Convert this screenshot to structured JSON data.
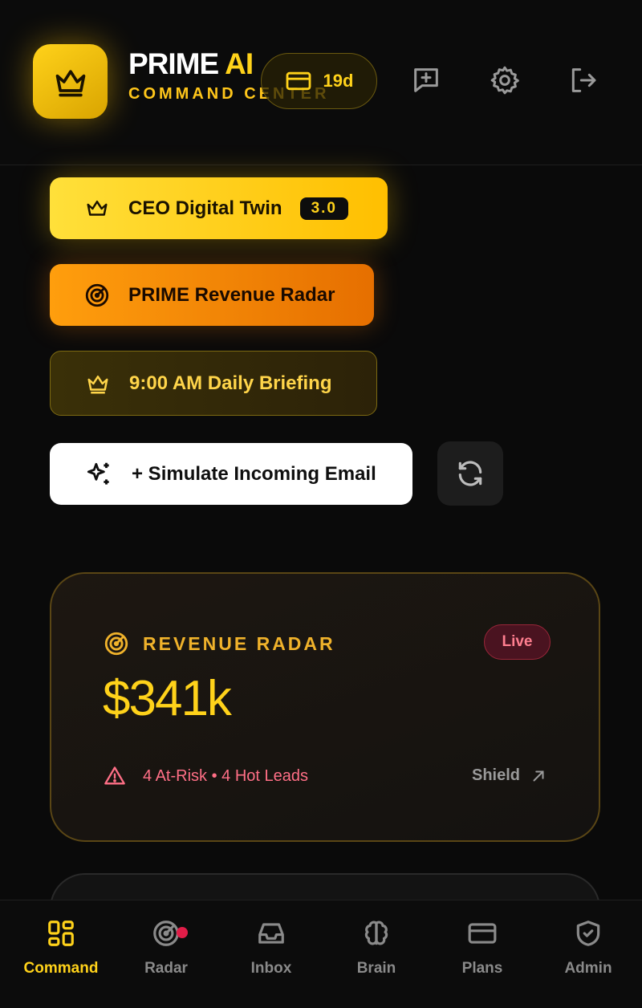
{
  "header": {
    "brand_main": "PRIME",
    "brand_ai": "AI",
    "subtitle": "COMMAND CENTER",
    "trial_days": "19d"
  },
  "actions": {
    "ceo_label": "CEO Digital Twin",
    "ceo_badge": "3.0",
    "radar_label": "PRIME Revenue Radar",
    "briefing_label": "9:00 AM Daily Briefing",
    "simulate_label": "+ Simulate Incoming Email"
  },
  "card": {
    "title": "REVENUE RADAR",
    "status": "Live",
    "amount": "$341k",
    "risk_text": "4 At-Risk • 4 Hot Leads",
    "link_label": "Shield"
  },
  "nav": {
    "items": [
      {
        "label": "Command",
        "icon": "grid-icon",
        "active": true
      },
      {
        "label": "Radar",
        "icon": "radar-icon",
        "has_dot": true
      },
      {
        "label": "Inbox",
        "icon": "inbox-icon"
      },
      {
        "label": "Brain",
        "icon": "brain-icon"
      },
      {
        "label": "Plans",
        "icon": "credit-card-icon"
      },
      {
        "label": "Admin",
        "icon": "shield-check-icon"
      }
    ]
  },
  "colors": {
    "accent": "#ffd21a",
    "orange": "#ff8c00",
    "danger": "#ff6f86",
    "background": "#0a0a0a"
  }
}
